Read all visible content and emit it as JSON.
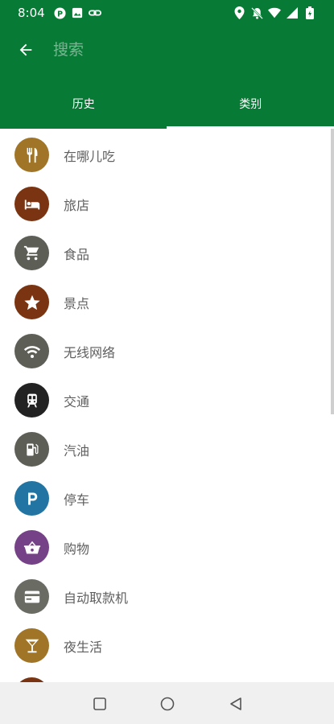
{
  "status_bar": {
    "time": "8:04",
    "icons": [
      "p-badge-icon",
      "image-icon",
      "link-icon",
      "location-icon",
      "bell-off-icon",
      "wifi-icon",
      "signal-icon",
      "battery-icon"
    ]
  },
  "header": {
    "back_icon": "arrow-left-icon",
    "search_placeholder": "搜索",
    "search_value": ""
  },
  "tabs": [
    {
      "label": "历史",
      "selected": false
    },
    {
      "label": "类别",
      "selected": true
    }
  ],
  "colors": {
    "primary": "#077a35",
    "tab_indicator": "#ffffff",
    "label_text": "#5f5f5f"
  },
  "categories": [
    {
      "label": "在哪儿吃",
      "icon": "fork-knife-icon",
      "color": "#a07528"
    },
    {
      "label": "旅店",
      "icon": "bed-icon",
      "color": "#7a3411"
    },
    {
      "label": "食品",
      "icon": "shopping-cart-icon",
      "color": "#5d5e55"
    },
    {
      "label": "景点",
      "icon": "star-icon",
      "color": "#7a3411"
    },
    {
      "label": "无线网络",
      "icon": "wifi-icon",
      "color": "#5d5e55"
    },
    {
      "label": "交通",
      "icon": "train-icon",
      "color": "#222222"
    },
    {
      "label": "汽油",
      "icon": "fuel-pump-icon",
      "color": "#5d5e55"
    },
    {
      "label": "停车",
      "icon": "parking-icon",
      "color": "#2275a3"
    },
    {
      "label": "购物",
      "icon": "basket-icon",
      "color": "#764287"
    },
    {
      "label": "自动取款机",
      "icon": "credit-card-icon",
      "color": "#6a6b63"
    },
    {
      "label": "夜生活",
      "icon": "cocktail-icon",
      "color": "#a07528"
    },
    {
      "label": "",
      "icon": "partial-icon",
      "color": "#7a3411"
    }
  ],
  "nav_bar": {
    "icons": [
      "recent-apps-icon",
      "home-icon",
      "back-icon"
    ]
  }
}
